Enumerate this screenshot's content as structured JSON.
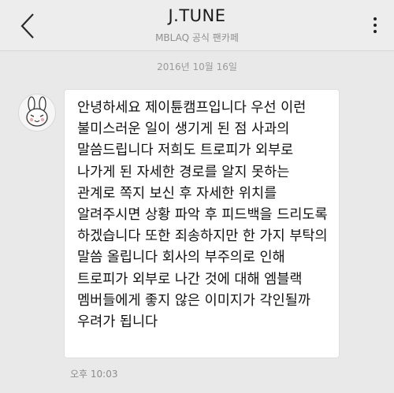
{
  "header": {
    "title": "J.TUNE",
    "subtitle": "MBLAQ 공식 팬카페",
    "back_icon": "chevron-left-icon",
    "menu_icon": "more-vertical-icon"
  },
  "chat": {
    "date": "2016년 10월 16일",
    "message": {
      "text": "안녕하세요 제이튠캠프입니다 우선 이런 불미스러운 일이 생기게 된 점 사과의 말씀드립니다 저희도 트로피가 외부로 나가게 된 자세한 경로를 알지 못하는 관계로 쪽지 보신 후 자세한 위치를 알려주시면 상황 파악 후 피드백을 드리도록 하겠습니다 또한 죄송하지만 한 가지 부탁의 말씀 올립니다 회사의 부주의로 인해 트로피가 외부로 나간 것에 대해 엠블랙 멤버들에게 좋지 않은 이미지가 각인될까 우려가 됩니다",
      "time": "오후 10:03"
    }
  }
}
